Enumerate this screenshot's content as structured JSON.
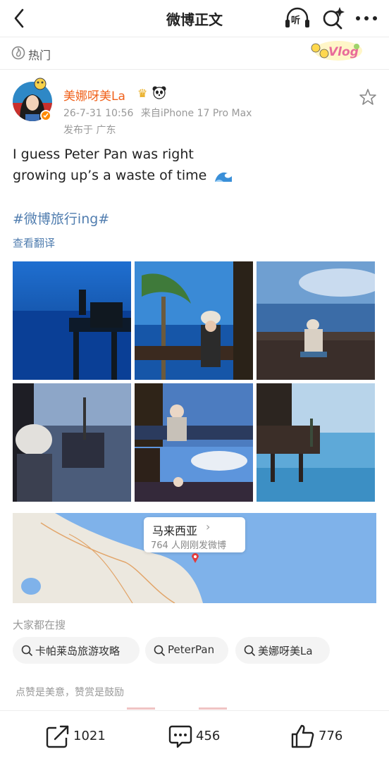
{
  "header": {
    "title": "微博正文",
    "listen_label": "听"
  },
  "hot": {
    "label": "热门",
    "badge_text": "Vlog"
  },
  "post": {
    "author": "美娜呀美La",
    "timestamp": "26-7-31 10:56",
    "source": "来自iPhone 17 Pro Max",
    "location_line": "发布于 广东",
    "text_line1": "I guess Peter Pan was right",
    "text_line2": "growing up’s a waste of time",
    "hashtag": "#微博旅行ing#",
    "translate": "查看翻译"
  },
  "map": {
    "country": "马来西亚",
    "people_posted": "764 人刚刚发微博"
  },
  "search": {
    "heading": "大家都在搜",
    "chips": [
      "卡帕莱岛旅游攻略",
      "PeterPan",
      "美娜呀美La"
    ]
  },
  "like_hint": "点赞是美意，赞赏是鼓励",
  "actions": {
    "repost_count": "1021",
    "comment_count": "456",
    "like_count": "776"
  },
  "icons": {
    "back": "back-arrow-icon",
    "listen": "listen-headphones-icon",
    "search": "search-sparkle-icon",
    "more": "more-dots-icon",
    "hot": "hot-fire-icon",
    "favorite": "star-icon",
    "repost": "repost-icon",
    "comment": "comment-icon",
    "like": "thumbs-up-icon"
  },
  "colors": {
    "username": "#f0611b",
    "link": "#507daf",
    "muted": "#999999"
  }
}
